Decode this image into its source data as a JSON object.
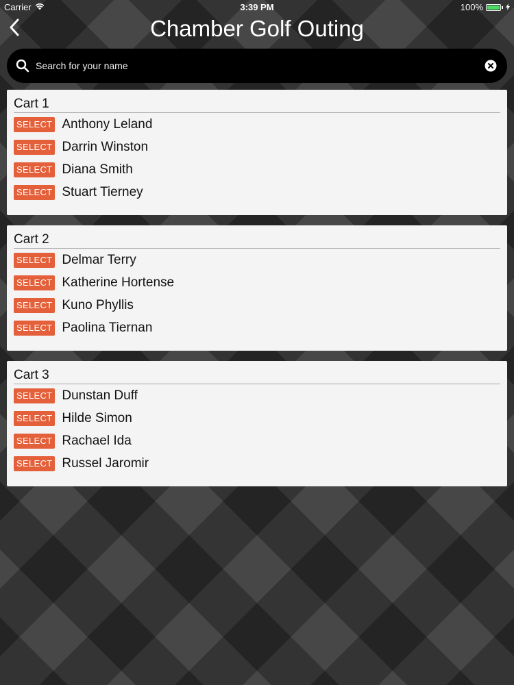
{
  "status_bar": {
    "carrier": "Carrier",
    "time": "3:39 PM",
    "battery": "100%",
    "battery_level": 100,
    "icons": [
      "wifi-icon",
      "battery-icon",
      "charging-icon"
    ]
  },
  "nav": {
    "title": "Chamber Golf Outing",
    "back_icon": "chevron-left-icon"
  },
  "search": {
    "placeholder": "Search for your name",
    "value": "",
    "icons": [
      "search-icon",
      "clear-icon"
    ]
  },
  "select_label": "SELECT",
  "carts": [
    {
      "title": "Cart 1",
      "players": [
        "Anthony Leland",
        "Darrin Winston",
        "Diana Smith",
        "Stuart Tierney"
      ]
    },
    {
      "title": "Cart 2",
      "players": [
        "Delmar Terry",
        "Katherine Hortense",
        "Kuno Phyllis",
        "Paolina Tiernan"
      ]
    },
    {
      "title": "Cart 3",
      "players": [
        "Dunstan Duff",
        "Hilde Simon",
        "Rachael Ida",
        "Russel Jaromir"
      ]
    }
  ],
  "colors": {
    "select_button": "#e4603a",
    "card_background": "#f4f4f4",
    "search_background": "#000000"
  }
}
